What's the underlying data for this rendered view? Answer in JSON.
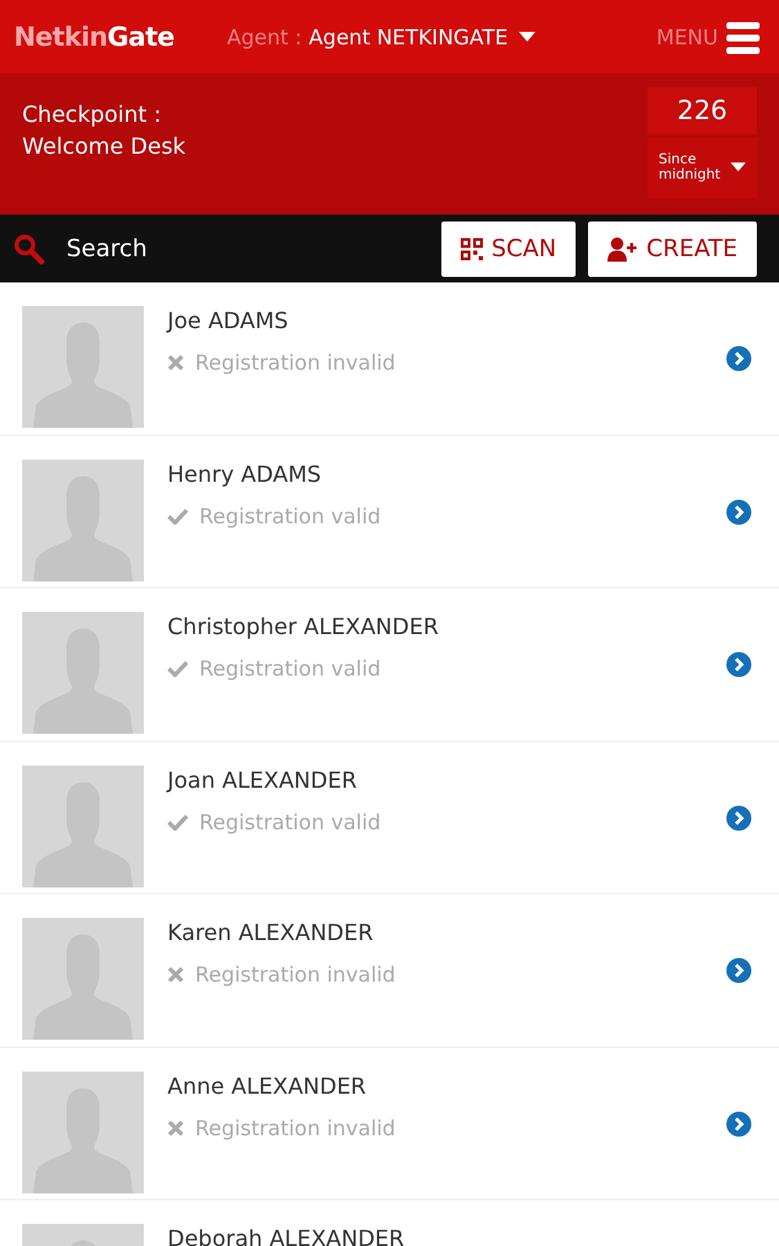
{
  "header": {
    "logo": "Netkin**Gate**",
    "agent_label": "Agent :",
    "agent_name": "Agent NETKINGATE",
    "menu_label": "MENU"
  },
  "checkpoint": {
    "label": "Checkpoint :",
    "name": "Welcome Desk",
    "count": "226",
    "period": "Since midnight"
  },
  "toolbar": {
    "search": {
      "placeholder": "Search"
    },
    "buttons": [
      {
        "label": "SCAN",
        "kind": "scan"
      },
      {
        "label": "CREATE",
        "kind": "create"
      }
    ]
  },
  "people": [
    {
      "name": "Joe ADAMS",
      "status": "Registration invalid",
      "valid": false
    },
    {
      "name": "Henry ADAMS",
      "status": "Registration valid",
      "valid": true
    },
    {
      "name": "Christopher ALEXANDER",
      "status": "Registration valid",
      "valid": true
    },
    {
      "name": "Joan ALEXANDER",
      "status": "Registration valid",
      "valid": true
    },
    {
      "name": "Karen ALEXANDER",
      "status": "Registration invalid",
      "valid": false
    },
    {
      "name": "Anne ALEXANDER",
      "status": "Registration invalid",
      "valid": false
    },
    {
      "name": "Deborah ALEXANDER"
    }
  ]
}
